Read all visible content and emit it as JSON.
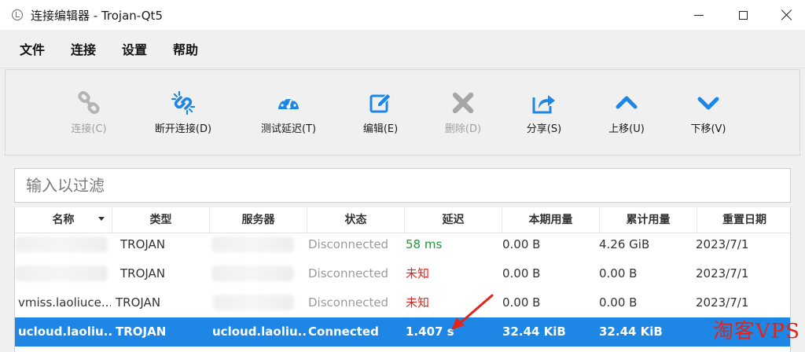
{
  "window": {
    "title": "连接编辑器 - Trojan-Qt5"
  },
  "menu": {
    "items": [
      "文件",
      "连接",
      "设置",
      "帮助"
    ]
  },
  "toolbar": {
    "buttons": [
      {
        "label": "连接(C)",
        "icon": "link-icon",
        "enabled": false
      },
      {
        "label": "断开连接(D)",
        "icon": "broken-link-icon",
        "enabled": true
      },
      {
        "label": "测试延迟(T)",
        "icon": "speedometer-icon",
        "enabled": true
      },
      {
        "label": "编辑(E)",
        "icon": "edit-icon",
        "enabled": true
      },
      {
        "label": "删除(D)",
        "icon": "delete-x-icon",
        "enabled": false
      },
      {
        "label": "分享(S)",
        "icon": "share-icon",
        "enabled": true
      },
      {
        "label": "上移(U)",
        "icon": "chevron-up-icon",
        "enabled": true
      },
      {
        "label": "下移(V)",
        "icon": "chevron-down-icon",
        "enabled": true
      }
    ],
    "colors": {
      "accent": "#1e87e5",
      "disabled": "#a0a0a0"
    }
  },
  "filter": {
    "placeholder": "输入以过滤"
  },
  "table": {
    "columns": [
      "名称",
      "类型",
      "服务器",
      "状态",
      "延迟",
      "本期用量",
      "累计用量",
      "重置日期"
    ],
    "sorted_column": "名称",
    "rows": [
      {
        "name": "",
        "type": "TROJAN",
        "server": "",
        "status": "Disconnected",
        "latency": "58 ms",
        "latency_color": "green",
        "period_usage": "0.00  B",
        "total_usage": "4.26  GiB",
        "reset_date": "2023/7/1",
        "selected": false
      },
      {
        "name": "",
        "type": "TROJAN",
        "server": "",
        "status": "Disconnected",
        "latency": "未知",
        "latency_color": "red",
        "period_usage": "0.00  B",
        "total_usage": "0.00  B",
        "reset_date": "2023/7/1",
        "selected": false
      },
      {
        "name": "vmiss.laoliuce...",
        "type": "TROJAN",
        "server": "",
        "status": "Disconnected",
        "latency": "未知",
        "latency_color": "red",
        "period_usage": "0.00  B",
        "total_usage": "0.00  B",
        "reset_date": "2023/7/1",
        "selected": false
      },
      {
        "name": "ucloud.laoliu...",
        "type": "TROJAN",
        "server": "ucloud.laoliu...",
        "status": "Connected",
        "latency": "1.407 s",
        "latency_color": "white",
        "period_usage": "32.44  KiB",
        "total_usage": "32.44  KiB",
        "reset_date": "",
        "selected": true
      }
    ],
    "colors": {
      "selected_bg": "#1e87e5",
      "green": "#1c9a36",
      "red": "#e0241b"
    }
  },
  "watermark": {
    "text": "淘客VPS"
  }
}
